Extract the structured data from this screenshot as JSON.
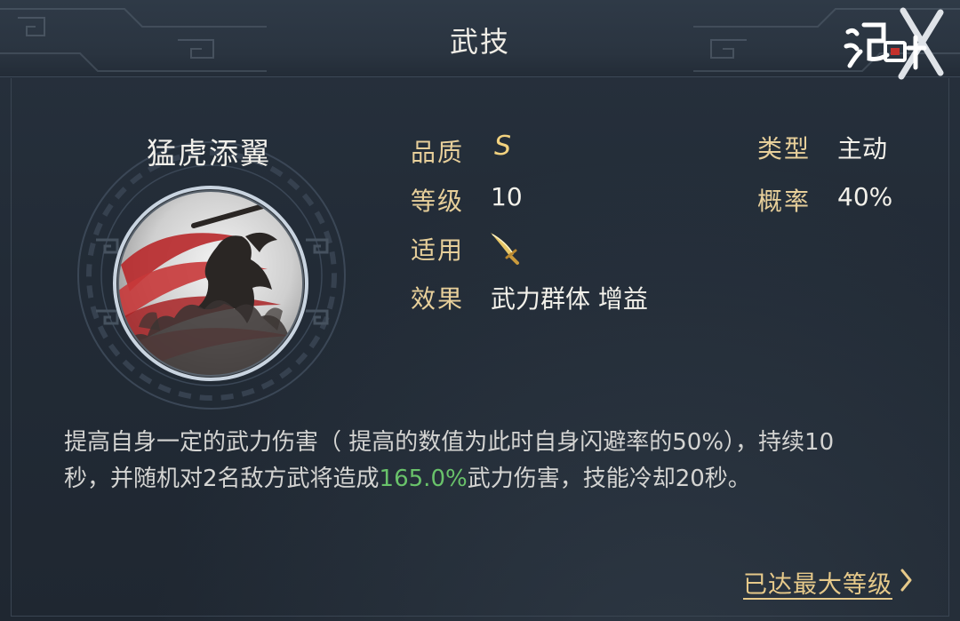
{
  "header": {
    "title": "武技",
    "logo": "鸿图"
  },
  "skill": {
    "name": "猛虎添翼",
    "attributes": {
      "quality_label": "品质",
      "quality_value": "S",
      "level_label": "等级",
      "level_value": "10",
      "applicable_label": "适用",
      "applicable_icon": "sword-icon",
      "effect_label": "效果",
      "effect_value": "武力群体 增益",
      "type_label": "类型",
      "type_value": "主动",
      "chance_label": "概率",
      "chance_value": "40%"
    },
    "description": {
      "part1": "提高自身一定的武力伤害（ 提高的数值为此时自身闪避率的50%），持续10秒，并随机对2名敌方武将造成",
      "highlight": "165.0%",
      "part2": "武力伤害，技能冷却20秒。"
    }
  },
  "footer": {
    "max_level_label": "已达最大等级"
  },
  "colors": {
    "gold": "#e7cf9a",
    "highlight_green": "#69c26a",
    "quality_gold": "#f2d27f"
  }
}
